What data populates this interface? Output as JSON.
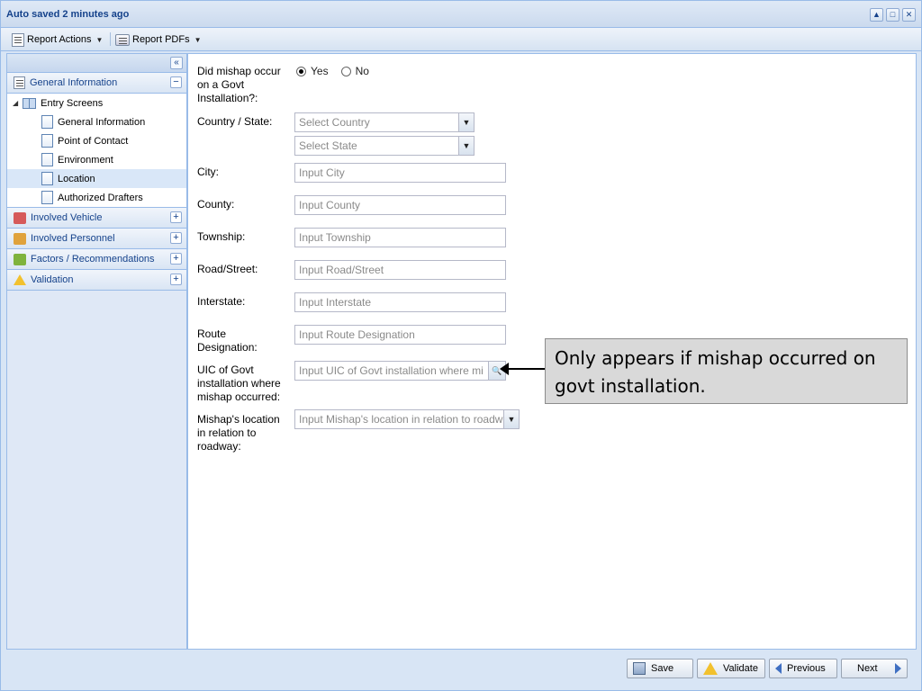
{
  "window": {
    "title": "Auto saved 2 minutes ago",
    "controls": [
      "restore-icon",
      "maximize-icon",
      "close-icon"
    ]
  },
  "toolbar": {
    "report_actions": "Report Actions",
    "report_pdfs": "Report PDFs"
  },
  "sidebar": {
    "general_information": "General Information",
    "entry_screens": "Entry Screens",
    "items": [
      {
        "label": "General Information"
      },
      {
        "label": "Point of Contact"
      },
      {
        "label": "Environment"
      },
      {
        "label": "Location",
        "selected": true
      },
      {
        "label": "Authorized Drafters"
      }
    ],
    "sections": [
      {
        "label": "Involved Vehicle"
      },
      {
        "label": "Involved Personnel"
      },
      {
        "label": "Factors / Recommendations"
      },
      {
        "label": "Validation"
      }
    ]
  },
  "form": {
    "mishap_govt": {
      "label": "Did mishap occur on a Govt Installation?:",
      "options": [
        "Yes",
        "No"
      ],
      "selected": "Yes"
    },
    "country_state": {
      "label": "Country / State:",
      "country_placeholder": "Select Country",
      "state_placeholder": "Select State"
    },
    "city": {
      "label": "City:",
      "placeholder": "Input City"
    },
    "county": {
      "label": "County:",
      "placeholder": "Input County"
    },
    "township": {
      "label": "Township:",
      "placeholder": "Input Township"
    },
    "road": {
      "label": "Road/Street:",
      "placeholder": "Input Road/Street"
    },
    "interstate": {
      "label": "Interstate:",
      "placeholder": "Input Interstate"
    },
    "route": {
      "label": "Route Designation:",
      "placeholder": "Input Route Designation"
    },
    "uic": {
      "label": "UIC of Govt installation where mishap occurred:",
      "placeholder": "Input UIC of Govt installation where mi"
    },
    "location_roadway": {
      "label": "Mishap's location in relation to roadway:",
      "placeholder": "Input Mishap's location in relation to roadw"
    }
  },
  "callout": {
    "text": "Only appears if mishap occurred on govt installation."
  },
  "footer": {
    "save": "Save",
    "validate": "Validate",
    "previous": "Previous",
    "next": "Next"
  },
  "colors": {
    "chrome": "#d8e5f5",
    "border": "#99bbe8",
    "title_text": "#15428b",
    "callout_bg": "#d9d9d9"
  }
}
